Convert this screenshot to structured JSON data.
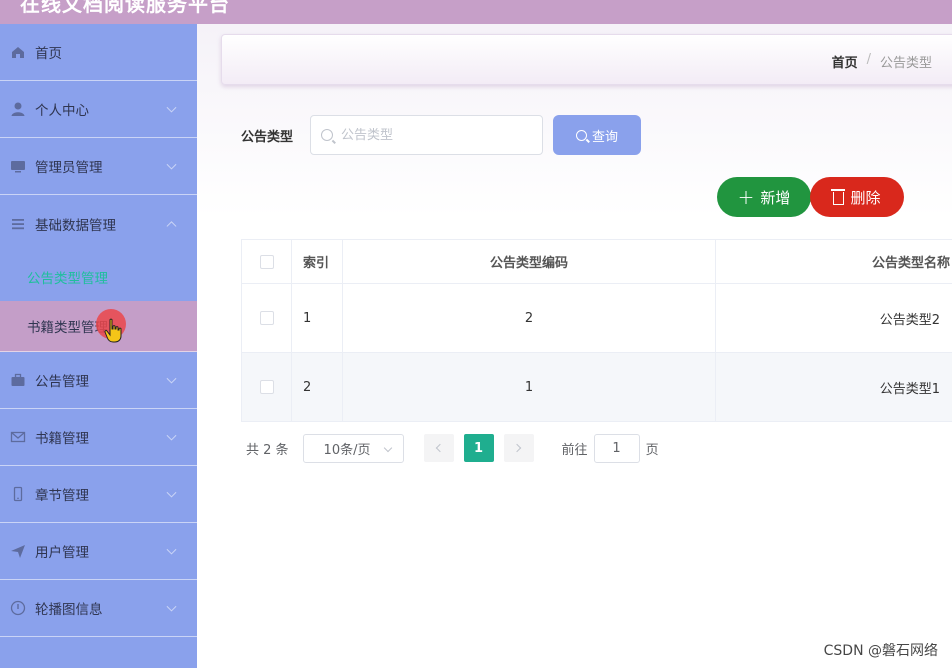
{
  "header": {
    "title": "在线文档阅读服务平台"
  },
  "sidebar": {
    "items": [
      {
        "label": "首页",
        "icon": "home-icon"
      },
      {
        "label": "个人中心",
        "icon": "user-icon"
      },
      {
        "label": "管理员管理",
        "icon": "monitor-icon"
      },
      {
        "label": "基础数据管理",
        "icon": "menu-icon"
      },
      {
        "label": "公告管理",
        "icon": "briefcase-icon"
      },
      {
        "label": "书籍管理",
        "icon": "mail-icon"
      },
      {
        "label": "章节管理",
        "icon": "phone-icon"
      },
      {
        "label": "用户管理",
        "icon": "send-icon"
      },
      {
        "label": "轮播图信息",
        "icon": "info-icon"
      }
    ],
    "subitems": [
      {
        "label": "公告类型管理",
        "state": "active"
      },
      {
        "label": "书籍类型管理",
        "state": "hover"
      }
    ]
  },
  "breadcrumb": {
    "home": "首页",
    "separator": "/",
    "current": "公告类型"
  },
  "search": {
    "label": "公告类型",
    "placeholder": "公告类型",
    "button": "查询"
  },
  "actions": {
    "add": "新增",
    "delete": "删除"
  },
  "table": {
    "headers": [
      "索引",
      "公告类型编码",
      "公告类型名称"
    ],
    "rows": [
      {
        "index": "1",
        "code": "2",
        "name": "公告类型2"
      },
      {
        "index": "2",
        "code": "1",
        "name": "公告类型1"
      }
    ]
  },
  "pagination": {
    "total": "共 2 条",
    "page_size": "10条/页",
    "current_page": "1",
    "goto_label": "前往",
    "goto_value": "1",
    "page_unit": "页"
  },
  "watermark": "CSDN @磐石网络",
  "colors": {
    "sidebar": "#8aa1ec",
    "header": "#c69fc8",
    "active_text": "#1fbf9d",
    "add": "#21953f",
    "delete": "#d9281c",
    "pager_active": "#1fae8f"
  }
}
